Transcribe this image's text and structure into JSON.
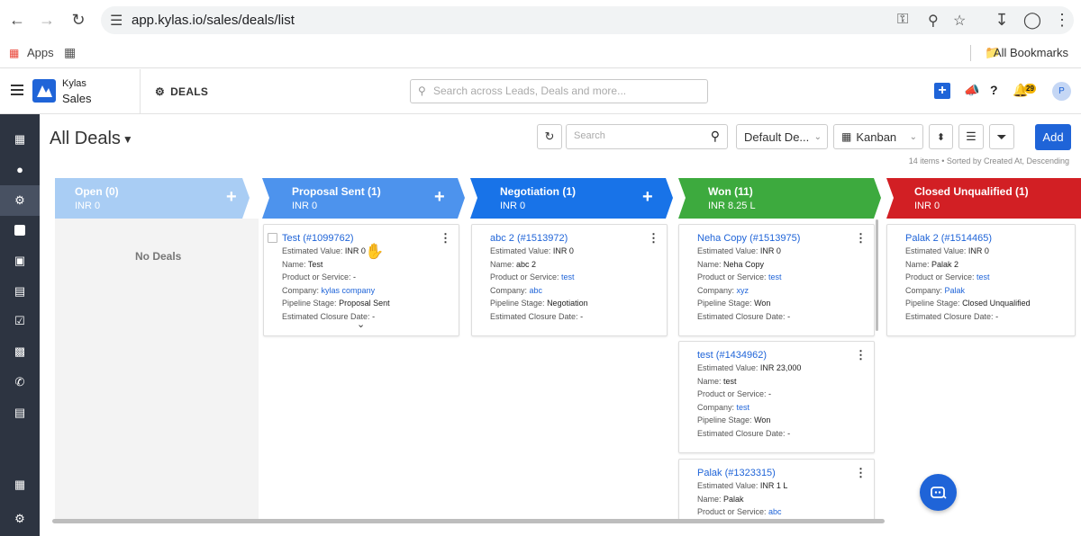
{
  "browser": {
    "url": "app.kylas.io/sales/deals/list",
    "bookmarks_apps": "Apps",
    "bookmarks_all": "All Bookmarks"
  },
  "header": {
    "brand_line1": "Kylas",
    "brand_line2": "Sales",
    "module": "DEALS",
    "search_placeholder": "Search across Leads, Deals and more...",
    "notification_count": "29",
    "avatar_initial": "P"
  },
  "toolbar": {
    "title": "All Deals",
    "search_placeholder": "Search",
    "view_selector": "Default De...",
    "layout_selector": "Kanban",
    "add_label": "Add",
    "meta": "14 items • Sorted by Created At, Descending"
  },
  "stages": [
    {
      "name": "Open (0)",
      "value": "INR 0",
      "color": "#a9cdf4"
    },
    {
      "name": "Proposal Sent (1)",
      "value": "INR 0",
      "color": "#4d93ed"
    },
    {
      "name": "Negotiation (1)",
      "value": "INR 0",
      "color": "#1873e8"
    },
    {
      "name": "Won (11)",
      "value": "INR 8.25 L",
      "color": "#3daa3e"
    },
    {
      "name": "Closed Unqualified (1)",
      "value": "INR 0",
      "color": "#d21f24"
    }
  ],
  "empty_column": "No Deals",
  "labels": {
    "estimated_value": "Estimated Value:",
    "name": "Name:",
    "product": "Product or Service:",
    "company": "Company:",
    "pipeline_stage": "Pipeline Stage:",
    "closure": "Estimated Closure Date:"
  },
  "cards": {
    "proposal": {
      "title": "Test (#1099762)",
      "value": "INR 0",
      "name": "Test",
      "product": "-",
      "company": "kylas company",
      "stage": "Proposal Sent",
      "closure": "-"
    },
    "negotiation": {
      "title": "abc 2 (#1513972)",
      "value": "INR 0",
      "name": "abc 2",
      "product": "test",
      "company": "abc",
      "stage": "Negotiation",
      "closure": "-"
    },
    "won1": {
      "title": "Neha Copy (#1513975)",
      "value": "INR 0",
      "name": "Neha Copy",
      "product": "test",
      "company": "xyz",
      "stage": "Won",
      "closure": "-"
    },
    "won2": {
      "title": "test (#1434962)",
      "value": "INR 23,000",
      "name": "test",
      "product": "-",
      "company": "test",
      "stage": "Won",
      "closure": "-"
    },
    "won3": {
      "title": "Palak (#1323315)",
      "value": "INR 1 L",
      "name": "Palak",
      "product": "abc"
    },
    "closed": {
      "title": "Palak 2 (#1514465)",
      "value": "INR 0",
      "name": "Palak 2",
      "product": "test",
      "company": "Palak",
      "stage": "Closed Unqualified",
      "closure": "-"
    }
  }
}
